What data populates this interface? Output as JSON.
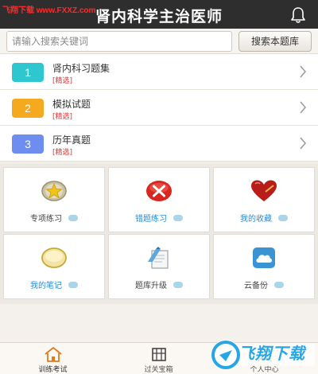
{
  "watermark": "飞翔下载 www.FXXZ.com",
  "header": {
    "title": "肾内科学主治医师",
    "notify_icon": "bell-icon"
  },
  "search": {
    "placeholder": "请输入搜索关键词",
    "button_label": "搜索本题库"
  },
  "list": [
    {
      "num": "1",
      "title": "肾内科习题集",
      "tag": "[精选]",
      "color": "#2ec6cf"
    },
    {
      "num": "2",
      "title": "模拟试题",
      "tag": "[精选]",
      "color": "#f5a91e"
    },
    {
      "num": "3",
      "title": "历年真题",
      "tag": "[精选]",
      "color": "#6e8df0"
    }
  ],
  "grid": [
    {
      "label": "专项练习",
      "icon": "star-badge-icon",
      "style": "gray"
    },
    {
      "label": "错题练习",
      "icon": "error-x-icon",
      "style": "blue"
    },
    {
      "label": "我的收藏",
      "icon": "heart-icon",
      "style": "blue"
    },
    {
      "label": "我的笔记",
      "icon": "notebook-icon",
      "style": "blue"
    },
    {
      "label": "题库升级",
      "icon": "upgrade-icon",
      "style": "gray"
    },
    {
      "label": "云备份",
      "icon": "cloud-icon",
      "style": "gray"
    }
  ],
  "nav": [
    {
      "label": "训练考试",
      "icon": "home-icon"
    },
    {
      "label": "过关宝箱",
      "icon": "treasure-box-icon"
    },
    {
      "label": "个人中心",
      "icon": "user-icon"
    }
  ],
  "logo": {
    "text": "飞翔下载"
  },
  "colors": {
    "header_bg": "#2e2e2e",
    "accent_blue": "#2a8bd6",
    "tag_red": "#d33"
  }
}
